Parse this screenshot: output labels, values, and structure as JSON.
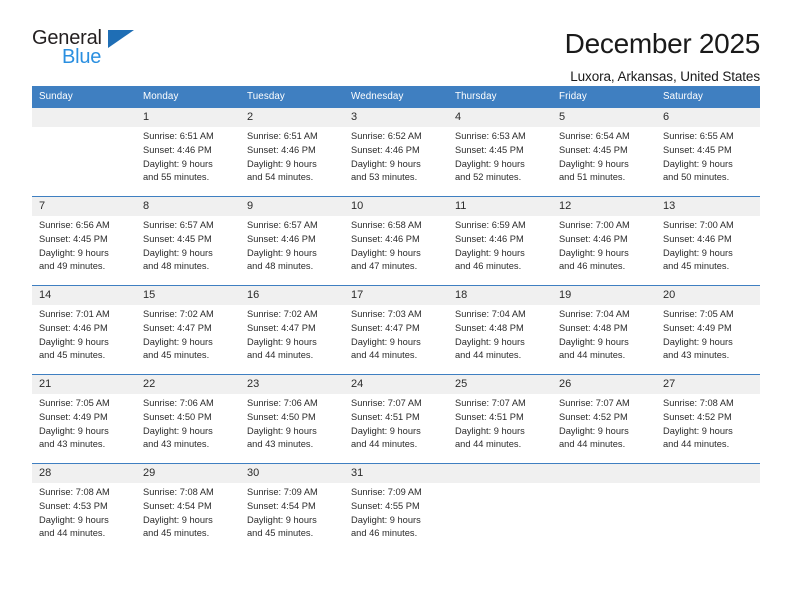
{
  "brand": {
    "line1": "General",
    "line2": "Blue",
    "triangle_icon": "triangle-icon",
    "accent": "#2a8fe0",
    "triangle_color": "#1f6eb5"
  },
  "header": {
    "title": "December 2025",
    "subtitle": "Luxora, Arkansas, United States"
  },
  "theme": {
    "header_blue": "#3f7fc1",
    "daynum_bg": "#f0f0f0",
    "text": "#2b2b2b"
  },
  "weekdays": [
    "Sunday",
    "Monday",
    "Tuesday",
    "Wednesday",
    "Thursday",
    "Friday",
    "Saturday"
  ],
  "labels": {
    "sunrise": "Sunrise:",
    "sunset": "Sunset:",
    "daylight": "Daylight:"
  },
  "weeks": [
    [
      {
        "empty": true
      },
      {
        "day": "1",
        "sunrise": "Sunrise: 6:51 AM",
        "sunset": "Sunset: 4:46 PM",
        "daylight1": "Daylight: 9 hours",
        "daylight2": "and 55 minutes."
      },
      {
        "day": "2",
        "sunrise": "Sunrise: 6:51 AM",
        "sunset": "Sunset: 4:46 PM",
        "daylight1": "Daylight: 9 hours",
        "daylight2": "and 54 minutes."
      },
      {
        "day": "3",
        "sunrise": "Sunrise: 6:52 AM",
        "sunset": "Sunset: 4:46 PM",
        "daylight1": "Daylight: 9 hours",
        "daylight2": "and 53 minutes."
      },
      {
        "day": "4",
        "sunrise": "Sunrise: 6:53 AM",
        "sunset": "Sunset: 4:45 PM",
        "daylight1": "Daylight: 9 hours",
        "daylight2": "and 52 minutes."
      },
      {
        "day": "5",
        "sunrise": "Sunrise: 6:54 AM",
        "sunset": "Sunset: 4:45 PM",
        "daylight1": "Daylight: 9 hours",
        "daylight2": "and 51 minutes."
      },
      {
        "day": "6",
        "sunrise": "Sunrise: 6:55 AM",
        "sunset": "Sunset: 4:45 PM",
        "daylight1": "Daylight: 9 hours",
        "daylight2": "and 50 minutes."
      }
    ],
    [
      {
        "day": "7",
        "sunrise": "Sunrise: 6:56 AM",
        "sunset": "Sunset: 4:45 PM",
        "daylight1": "Daylight: 9 hours",
        "daylight2": "and 49 minutes."
      },
      {
        "day": "8",
        "sunrise": "Sunrise: 6:57 AM",
        "sunset": "Sunset: 4:45 PM",
        "daylight1": "Daylight: 9 hours",
        "daylight2": "and 48 minutes."
      },
      {
        "day": "9",
        "sunrise": "Sunrise: 6:57 AM",
        "sunset": "Sunset: 4:46 PM",
        "daylight1": "Daylight: 9 hours",
        "daylight2": "and 48 minutes."
      },
      {
        "day": "10",
        "sunrise": "Sunrise: 6:58 AM",
        "sunset": "Sunset: 4:46 PM",
        "daylight1": "Daylight: 9 hours",
        "daylight2": "and 47 minutes."
      },
      {
        "day": "11",
        "sunrise": "Sunrise: 6:59 AM",
        "sunset": "Sunset: 4:46 PM",
        "daylight1": "Daylight: 9 hours",
        "daylight2": "and 46 minutes."
      },
      {
        "day": "12",
        "sunrise": "Sunrise: 7:00 AM",
        "sunset": "Sunset: 4:46 PM",
        "daylight1": "Daylight: 9 hours",
        "daylight2": "and 46 minutes."
      },
      {
        "day": "13",
        "sunrise": "Sunrise: 7:00 AM",
        "sunset": "Sunset: 4:46 PM",
        "daylight1": "Daylight: 9 hours",
        "daylight2": "and 45 minutes."
      }
    ],
    [
      {
        "day": "14",
        "sunrise": "Sunrise: 7:01 AM",
        "sunset": "Sunset: 4:46 PM",
        "daylight1": "Daylight: 9 hours",
        "daylight2": "and 45 minutes."
      },
      {
        "day": "15",
        "sunrise": "Sunrise: 7:02 AM",
        "sunset": "Sunset: 4:47 PM",
        "daylight1": "Daylight: 9 hours",
        "daylight2": "and 45 minutes."
      },
      {
        "day": "16",
        "sunrise": "Sunrise: 7:02 AM",
        "sunset": "Sunset: 4:47 PM",
        "daylight1": "Daylight: 9 hours",
        "daylight2": "and 44 minutes."
      },
      {
        "day": "17",
        "sunrise": "Sunrise: 7:03 AM",
        "sunset": "Sunset: 4:47 PM",
        "daylight1": "Daylight: 9 hours",
        "daylight2": "and 44 minutes."
      },
      {
        "day": "18",
        "sunrise": "Sunrise: 7:04 AM",
        "sunset": "Sunset: 4:48 PM",
        "daylight1": "Daylight: 9 hours",
        "daylight2": "and 44 minutes."
      },
      {
        "day": "19",
        "sunrise": "Sunrise: 7:04 AM",
        "sunset": "Sunset: 4:48 PM",
        "daylight1": "Daylight: 9 hours",
        "daylight2": "and 44 minutes."
      },
      {
        "day": "20",
        "sunrise": "Sunrise: 7:05 AM",
        "sunset": "Sunset: 4:49 PM",
        "daylight1": "Daylight: 9 hours",
        "daylight2": "and 43 minutes."
      }
    ],
    [
      {
        "day": "21",
        "sunrise": "Sunrise: 7:05 AM",
        "sunset": "Sunset: 4:49 PM",
        "daylight1": "Daylight: 9 hours",
        "daylight2": "and 43 minutes."
      },
      {
        "day": "22",
        "sunrise": "Sunrise: 7:06 AM",
        "sunset": "Sunset: 4:50 PM",
        "daylight1": "Daylight: 9 hours",
        "daylight2": "and 43 minutes."
      },
      {
        "day": "23",
        "sunrise": "Sunrise: 7:06 AM",
        "sunset": "Sunset: 4:50 PM",
        "daylight1": "Daylight: 9 hours",
        "daylight2": "and 43 minutes."
      },
      {
        "day": "24",
        "sunrise": "Sunrise: 7:07 AM",
        "sunset": "Sunset: 4:51 PM",
        "daylight1": "Daylight: 9 hours",
        "daylight2": "and 44 minutes."
      },
      {
        "day": "25",
        "sunrise": "Sunrise: 7:07 AM",
        "sunset": "Sunset: 4:51 PM",
        "daylight1": "Daylight: 9 hours",
        "daylight2": "and 44 minutes."
      },
      {
        "day": "26",
        "sunrise": "Sunrise: 7:07 AM",
        "sunset": "Sunset: 4:52 PM",
        "daylight1": "Daylight: 9 hours",
        "daylight2": "and 44 minutes."
      },
      {
        "day": "27",
        "sunrise": "Sunrise: 7:08 AM",
        "sunset": "Sunset: 4:52 PM",
        "daylight1": "Daylight: 9 hours",
        "daylight2": "and 44 minutes."
      }
    ],
    [
      {
        "day": "28",
        "sunrise": "Sunrise: 7:08 AM",
        "sunset": "Sunset: 4:53 PM",
        "daylight1": "Daylight: 9 hours",
        "daylight2": "and 44 minutes."
      },
      {
        "day": "29",
        "sunrise": "Sunrise: 7:08 AM",
        "sunset": "Sunset: 4:54 PM",
        "daylight1": "Daylight: 9 hours",
        "daylight2": "and 45 minutes."
      },
      {
        "day": "30",
        "sunrise": "Sunrise: 7:09 AM",
        "sunset": "Sunset: 4:54 PM",
        "daylight1": "Daylight: 9 hours",
        "daylight2": "and 45 minutes."
      },
      {
        "day": "31",
        "sunrise": "Sunrise: 7:09 AM",
        "sunset": "Sunset: 4:55 PM",
        "daylight1": "Daylight: 9 hours",
        "daylight2": "and 46 minutes."
      },
      {
        "empty": true
      },
      {
        "empty": true
      },
      {
        "empty": true
      }
    ]
  ]
}
